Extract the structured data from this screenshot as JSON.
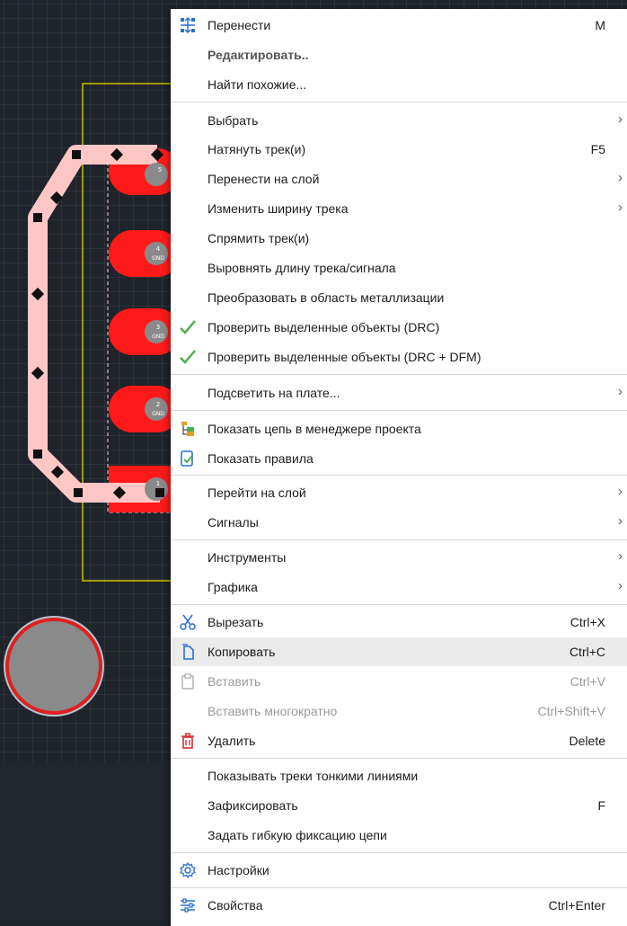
{
  "board": {
    "pads": [
      {
        "number": "5",
        "net": ""
      },
      {
        "number": "4",
        "net": "GND"
      },
      {
        "number": "3",
        "net": "GND"
      },
      {
        "number": "2",
        "net": "GND"
      },
      {
        "number": "1",
        "net": ""
      }
    ]
  },
  "menu": {
    "items": [
      {
        "label": "Перенести",
        "shortcut": "M",
        "icon": "move-icon"
      },
      {
        "label": "Редактировать..",
        "style": "bold"
      },
      {
        "label": "Найти похожие..."
      },
      {
        "label": "Выбрать",
        "submenu": "›"
      },
      {
        "label": "Натянуть трек(и)",
        "shortcut": "F5"
      },
      {
        "label": "Перенести на слой",
        "submenu": "›"
      },
      {
        "label": "Изменить ширину трека",
        "submenu": "›"
      },
      {
        "label": "Спрямить трек(и)"
      },
      {
        "label": "Выровнять длину трека/сигнала"
      },
      {
        "label": "Преобразовать в область металлизации"
      },
      {
        "label": "Проверить выделенные объекты (DRC)",
        "icon": "checkmark-icon"
      },
      {
        "label": "Проверить выделенные объекты (DRC + DFM)",
        "icon": "checkmark-icon"
      },
      {
        "label": "Подсветить на плате...",
        "submenu": "›"
      },
      {
        "label": "Показать цепь в менеджере проекта",
        "icon": "project-tree-icon"
      },
      {
        "label": "Показать правила",
        "icon": "rules-icon"
      },
      {
        "label": "Перейти на слой",
        "submenu": "›"
      },
      {
        "label": "Сигналы",
        "submenu": "›"
      },
      {
        "label": "Инструменты",
        "submenu": "›"
      },
      {
        "label": "Графика",
        "submenu": "›"
      },
      {
        "label": "Вырезать",
        "shortcut": "Ctrl+X",
        "icon": "scissors-icon"
      },
      {
        "label": "Копировать",
        "shortcut": "Ctrl+C",
        "icon": "copy-icon",
        "state": "hover"
      },
      {
        "label": "Вставить",
        "shortcut": "Ctrl+V",
        "icon": "paste-icon",
        "state": "disabled"
      },
      {
        "label": "Вставить многократно",
        "shortcut": "Ctrl+Shift+V",
        "state": "disabled"
      },
      {
        "label": "Удалить",
        "shortcut": "Delete",
        "icon": "trash-icon"
      },
      {
        "label": "Показывать треки тонкими линиями"
      },
      {
        "label": "Зафиксировать",
        "shortcut": "F"
      },
      {
        "label": "Задать гибкую фиксацию цепи"
      },
      {
        "label": "Настройки",
        "icon": "gear-icon"
      },
      {
        "label": "Свойства",
        "shortcut": "Ctrl+Enter",
        "icon": "sliders-icon"
      }
    ]
  },
  "colors": {
    "board_background": "#1f232a",
    "grid": "#3a414b",
    "outline": "#c8c000",
    "pad": "#ff1a1a",
    "track": "#ffc6c6",
    "pad_label": "#8a8a8a",
    "accent_green": "#4caf50",
    "accent_blue": "#2a6fd6",
    "danger": "#d93030"
  }
}
